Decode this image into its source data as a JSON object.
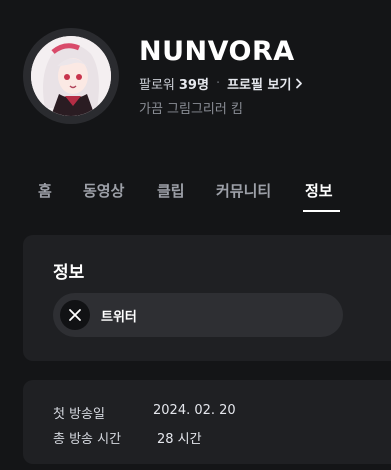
{
  "channel": {
    "name": "NUNVORA",
    "followers_label": "팔로워",
    "followers_count": "39명",
    "separator": "·",
    "profile_link": "프로필 보기",
    "description": "가끔 그림그리러 킴"
  },
  "tabs": [
    {
      "label": "홈"
    },
    {
      "label": "동영상"
    },
    {
      "label": "클립"
    },
    {
      "label": "커뮤니티"
    },
    {
      "label": "정보",
      "active": true
    }
  ],
  "info": {
    "title": "정보",
    "social": {
      "label": "트위터",
      "icon": "x-icon"
    }
  },
  "details": [
    {
      "label": "첫 방송일",
      "value": "2024. 02. 20"
    },
    {
      "label": "총 방송 시간",
      "value": "28 시간"
    }
  ],
  "colors": {
    "background": "#141517",
    "card": "#1f2023",
    "pill": "#2e2f33",
    "text_primary": "#ffffff",
    "text_muted": "#8a8d95"
  }
}
